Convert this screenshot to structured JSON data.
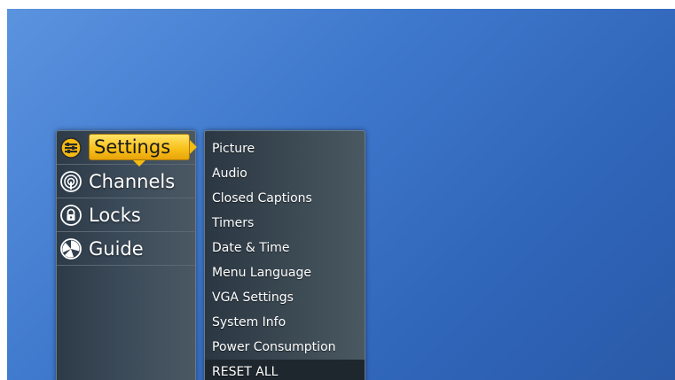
{
  "main_menu": {
    "items": [
      {
        "label": "Settings",
        "icon": "settings-sliders-icon",
        "selected": true
      },
      {
        "label": "Channels",
        "icon": "antenna-signal-icon",
        "selected": false
      },
      {
        "label": "Locks",
        "icon": "lock-icon",
        "selected": false
      },
      {
        "label": "Guide",
        "icon": "guide-dial-icon",
        "selected": false
      }
    ]
  },
  "sub_menu": {
    "items": [
      {
        "label": "Picture"
      },
      {
        "label": "Audio"
      },
      {
        "label": "Closed Captions"
      },
      {
        "label": "Timers"
      },
      {
        "label": "Date & Time"
      },
      {
        "label": "Menu Language"
      },
      {
        "label": "VGA Settings"
      },
      {
        "label": "System Info"
      },
      {
        "label": "Power Consumption"
      },
      {
        "label": "RESET ALL"
      }
    ]
  },
  "colors": {
    "highlight": "#f9c21a",
    "background": "#3e78cc",
    "panel": "#3b4a58"
  }
}
